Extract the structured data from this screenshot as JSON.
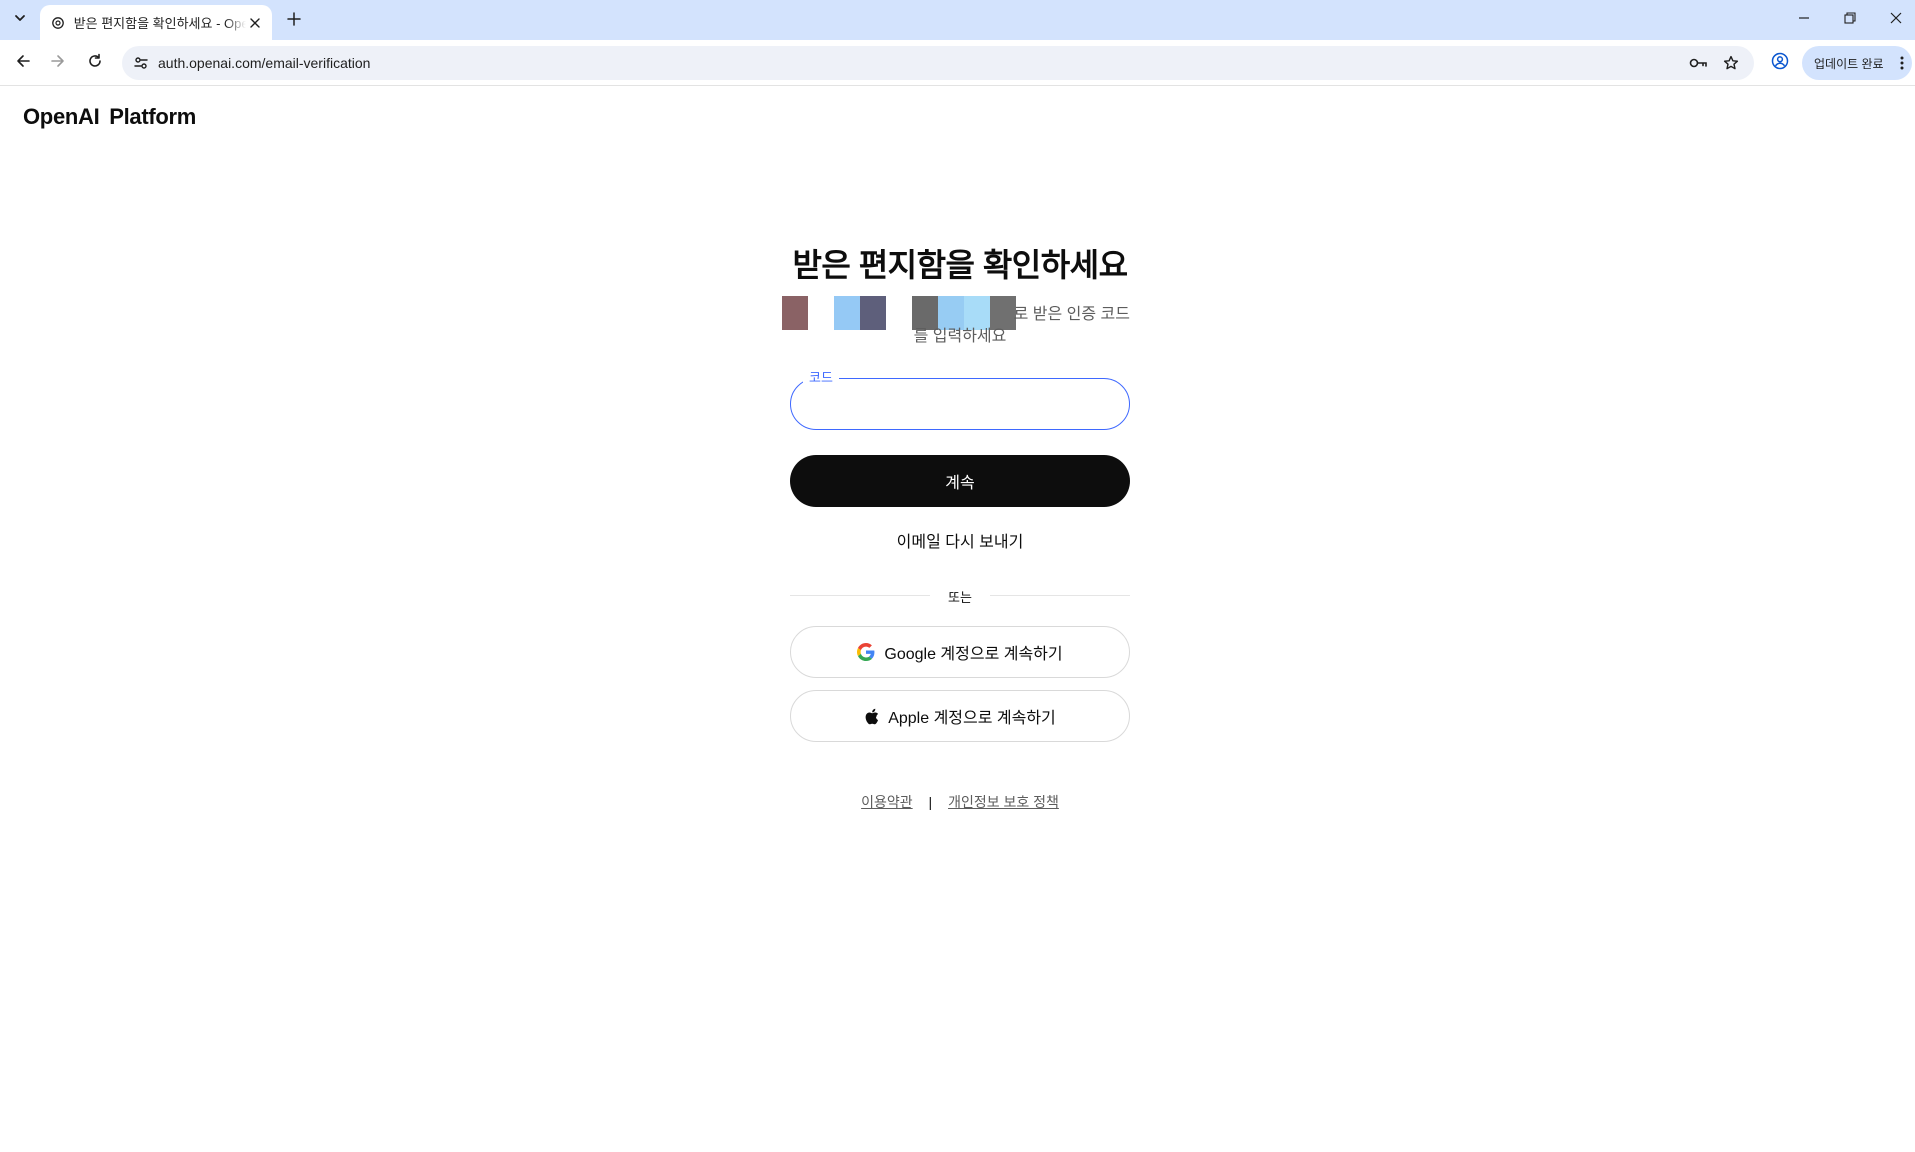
{
  "browser": {
    "tab": {
      "title": "받은 편지함을 확인하세요 - OpenAI",
      "favicon": "openai-icon"
    },
    "url": "auth.openai.com/email-verification",
    "update_label": "업데이트 완료",
    "icons": {
      "tab_list": "chevron-down-icon",
      "new_tab": "plus-icon",
      "back": "back-arrow-icon",
      "forward": "forward-arrow-icon",
      "reload": "reload-icon",
      "site_info": "tune-icon",
      "password": "key-icon",
      "bookmark": "star-icon",
      "profile": "profile-icon",
      "minimize": "minimize-icon",
      "restore": "restore-icon",
      "close": "close-icon"
    }
  },
  "page": {
    "brand": "OpenAI Platform",
    "heading": "받은 편지함을 확인하세요",
    "subtitle_line1": "로 받은 인증 코드",
    "subtitle_line2": "를 입력하세요",
    "redacted_email_colors": [
      "#8a6265",
      "#ffffff",
      "#95c9f5",
      "#5e5f7b",
      "#ffffff",
      "#6a6a6a",
      "#97ccf3",
      "#a8dcf8",
      "#707070"
    ],
    "code_field": {
      "label": "코드",
      "value": ""
    },
    "continue_label": "계속",
    "resend_label": "이메일 다시 보내기",
    "divider_label": "또는",
    "google_label": "Google 계정으로 계속하기",
    "apple_label": "Apple 계정으로 계속하기",
    "terms_label": "이용약관",
    "separator": "|",
    "privacy_label": "개인정보 보호 정책"
  },
  "colors": {
    "accent": "#3e68ff",
    "primary_button": "#0d0d0d",
    "tabstrip": "#d3e3fd"
  }
}
